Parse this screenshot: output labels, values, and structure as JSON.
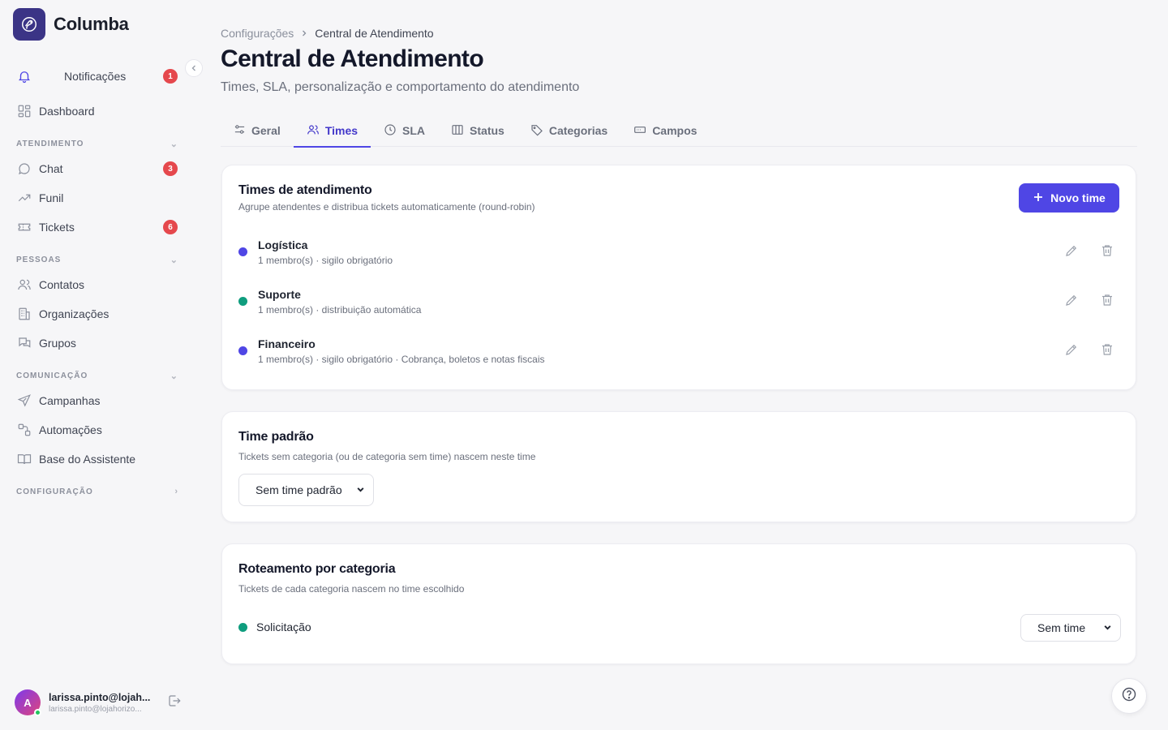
{
  "brand": {
    "name": "Columba"
  },
  "sidebar": {
    "notifications": {
      "label": "Notificações",
      "badge": "1"
    },
    "dashboard": {
      "label": "Dashboard"
    },
    "sections": [
      {
        "title": "ATENDIMENTO",
        "items": [
          {
            "label": "Chat",
            "badge": "3"
          },
          {
            "label": "Funil"
          },
          {
            "label": "Tickets",
            "badge": "6"
          }
        ]
      },
      {
        "title": "PESSOAS",
        "items": [
          {
            "label": "Contatos"
          },
          {
            "label": "Organizações"
          },
          {
            "label": "Grupos"
          }
        ]
      },
      {
        "title": "COMUNICAÇÃO",
        "items": [
          {
            "label": "Campanhas"
          },
          {
            "label": "Automações"
          },
          {
            "label": "Base do Assistente"
          }
        ]
      },
      {
        "title": "CONFIGURAÇÃO",
        "items": []
      }
    ],
    "user": {
      "initial": "A",
      "name": "larissa.pinto@lojah...",
      "email": "larissa.pinto@lojahorizo..."
    }
  },
  "header": {
    "breadcrumb": {
      "parent": "Configurações",
      "current": "Central de Atendimento"
    },
    "title": "Central de Atendimento",
    "subtitle": "Times, SLA, personalização e comportamento do atendimento"
  },
  "tabs": [
    {
      "label": "Geral",
      "icon": "sliders-icon"
    },
    {
      "label": "Times",
      "icon": "users-icon",
      "active": true
    },
    {
      "label": "SLA",
      "icon": "clock-icon"
    },
    {
      "label": "Status",
      "icon": "columns-icon"
    },
    {
      "label": "Categorias",
      "icon": "tag-icon"
    },
    {
      "label": "Campos",
      "icon": "input-field-icon"
    }
  ],
  "teams_card": {
    "title": "Times de atendimento",
    "description": "Agrupe atendentes e distribua tickets automaticamente (round-robin)",
    "new_button": "Novo time",
    "teams": [
      {
        "name": "Logística",
        "meta": "1 membro(s) · sigilo obrigatório",
        "color": "#4f46e5"
      },
      {
        "name": "Suporte",
        "meta": "1 membro(s) · distribuição automática",
        "color": "#0f9d7e"
      },
      {
        "name": "Financeiro",
        "meta": "1 membro(s) · sigilo obrigatório · Cobrança, boletos e notas fiscais",
        "color": "#4f46e5"
      }
    ]
  },
  "default_team_card": {
    "title": "Time padrão",
    "description": "Tickets sem categoria (ou de categoria sem time) nascem neste time",
    "select_value": "Sem time padrão"
  },
  "routing_card": {
    "title": "Roteamento por categoria",
    "description": "Tickets de cada categoria nascem no time escolhido",
    "rows": [
      {
        "label": "Solicitação",
        "color": "#0f9d7e",
        "select_value": "Sem time"
      }
    ]
  },
  "colors": {
    "accent": "#4f46e5",
    "badge": "#e5484d",
    "brand_logo": "#3b3486"
  }
}
